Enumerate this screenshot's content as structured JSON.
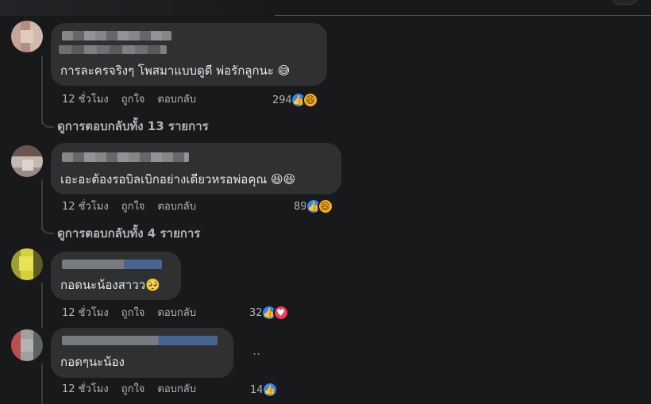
{
  "comments": [
    {
      "text": "การละครจริงๆ โพสมาแบบดูดี พ่อรักลูกนะ 😅",
      "time": "12 ชั่วโมง",
      "like_label": "ถูกใจ",
      "reply_label": "ตอบกลับ",
      "reaction_count": "294",
      "reaction_icons": [
        "like-icon",
        "haha-icon"
      ],
      "view_replies": "ดูการตอบกลับทั้ง 13 รายการ"
    },
    {
      "text": "เอะอะต้องรอบิลเบิกอย่างเดียวหรอพ่อคุณ 😆😆",
      "time": "12 ชั่วโมง",
      "like_label": "ถูกใจ",
      "reply_label": "ตอบกลับ",
      "reaction_count": "89",
      "reaction_icons": [
        "like-icon",
        "haha-icon"
      ],
      "view_replies": "ดูการตอบกลับทั้ง 4 รายการ"
    },
    {
      "text": "กอดนะน้องสาวว🥺",
      "time": "12 ชั่วโมง",
      "like_label": "ถูกใจ",
      "reply_label": "ตอบกลับ",
      "reaction_count": "32",
      "reaction_icons": [
        "like-icon",
        "love-icon"
      ]
    },
    {
      "text": "กอดๆนะน้อง",
      "time": "12 ชั่วโมง",
      "like_label": "ถูกใจ",
      "reply_label": "ตอบกลับ",
      "reaction_count": "14",
      "reaction_icons": [
        "like-icon"
      ]
    }
  ],
  "colors": {
    "background": "#18191a",
    "bubble": "#2f3031",
    "text_primary": "#e4e6eb",
    "text_secondary": "#b0b3b8",
    "like_blue": "#2d88ff",
    "haha_yellow": "#f7b125",
    "love_red": "#f33e58"
  }
}
